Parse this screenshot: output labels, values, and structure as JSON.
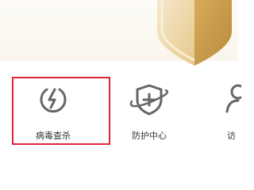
{
  "tiles": [
    {
      "label": "病毒查杀",
      "icon": "power-bolt-icon",
      "selected": true
    },
    {
      "label": "防护中心",
      "icon": "shield-plus-icon",
      "selected": false
    },
    {
      "label": "访",
      "icon": "person-icon",
      "selected": false
    }
  ],
  "colors": {
    "selection_border": "#e0243a",
    "icon_stroke": "#666666",
    "gold_light": "#f1e0b0",
    "gold_dark": "#c49a4a"
  }
}
